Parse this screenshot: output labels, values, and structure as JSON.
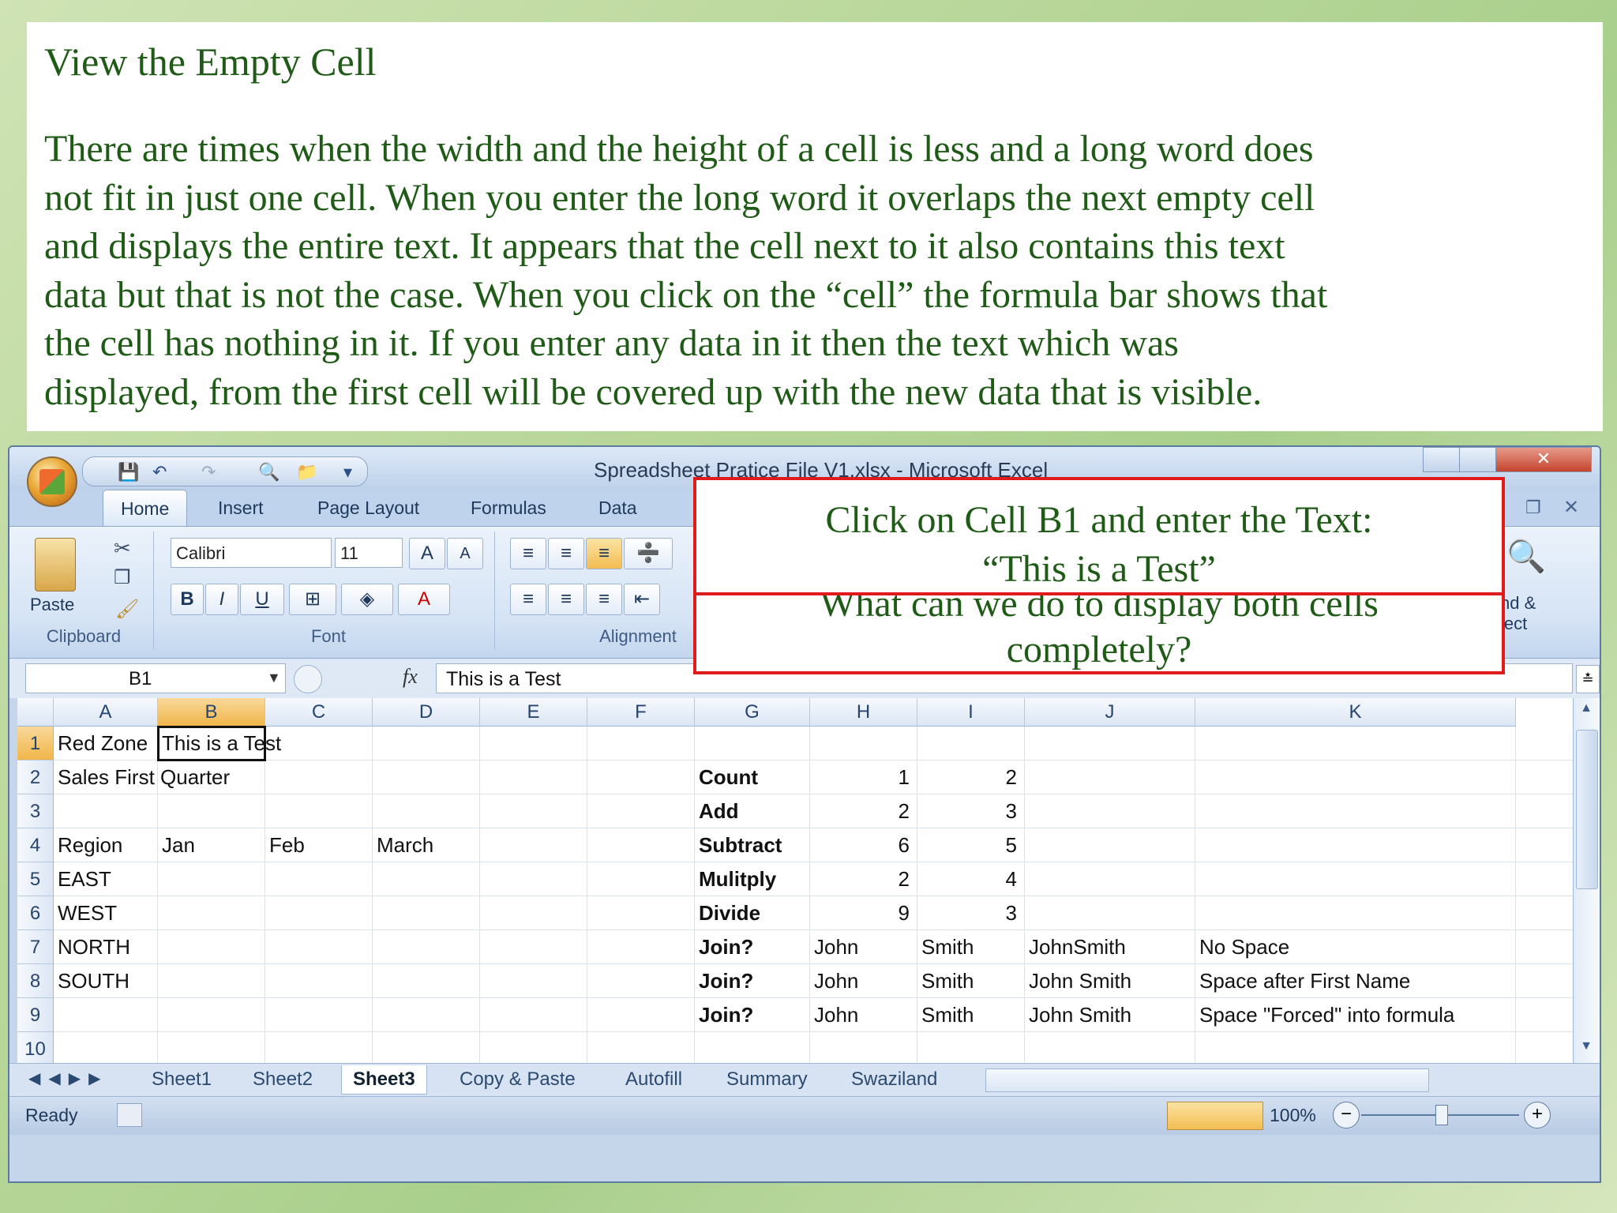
{
  "slide": {
    "title": "View the Empty Cell",
    "body_lines": [
      "There are times when the width and the height of a cell is less and a long word does",
      "not fit in just one cell.  When you enter the long word it overlaps the next empty cell",
      "and displays the entire text.  It appears that the cell next to it also contains this text",
      "data but that is not the case.  When you click on the “cell” the formula bar shows that",
      "the cell has nothing in it.  If you enter any data in it then the text which was",
      "displayed, from the first cell will be covered up with the new data that is visible."
    ]
  },
  "window": {
    "title": "Spreadsheet Pratice File V1.xlsx - Microsoft Excel"
  },
  "ribbon": {
    "tabs": [
      "Home",
      "Insert",
      "Page Layout",
      "Formulas",
      "Data"
    ],
    "groups": {
      "clipboard": "Clipboard",
      "font": "Font",
      "alignment": "Alignment"
    },
    "paste_label": "Paste",
    "font_name": "Calibri",
    "font_size": "11",
    "find_select_label": "nd &\nlect"
  },
  "formula_bar": {
    "name_box": "B1",
    "fx": "fx",
    "content": "This is a Test"
  },
  "grid": {
    "columns": [
      "A",
      "B",
      "C",
      "D",
      "E",
      "F",
      "G",
      "H",
      "I",
      "J",
      "K"
    ],
    "rows": [
      "1",
      "2",
      "3",
      "4",
      "5",
      "6",
      "7",
      "8",
      "9",
      "10"
    ],
    "cells": {
      "A1": "Red Zone",
      "B1": "This is a Test",
      "A2": "Sales First Quarter",
      "A4": "Region",
      "B4": "Jan",
      "C4": "Feb",
      "D4": "March",
      "A5": "EAST",
      "A6": "WEST",
      "A7": "NORTH",
      "A8": "SOUTH",
      "G2": "Count",
      "H2": "1",
      "I2": "2",
      "G3": "Add",
      "H3": "2",
      "I3": "3",
      "G4": "Subtract",
      "H4": "6",
      "I4": "5",
      "G5": "Mulitply",
      "H5": "2",
      "I5": "4",
      "G6": "Divide",
      "H6": "9",
      "I6": "3",
      "G7": "Join?",
      "H7": "John",
      "I7": "Smith",
      "J7": "JohnSmith",
      "K7": "No Space",
      "G8": "Join?",
      "H8": "John",
      "I8": "Smith",
      "J8": "John Smith",
      "K8": "Space after First Name",
      "G9": "Join?",
      "H9": "John",
      "I9": "Smith",
      "J9": "John Smith",
      "K9": "Space \"Forced\" into formula"
    }
  },
  "sheet_tabs": [
    "Sheet1",
    "Sheet2",
    "Sheet3",
    "Copy & Paste",
    "Autofill",
    "Summary",
    "Swaziland"
  ],
  "active_sheet": "Sheet3",
  "status": {
    "ready": "Ready",
    "zoom": "100%"
  },
  "callouts": {
    "top": [
      "Click on Cell B1 and enter the Text:",
      "“This is a Test”"
    ],
    "bottom": [
      "What can we do to display both cells",
      "completely?"
    ]
  },
  "colors": {
    "slide_text": "#1f5b17",
    "callout_border": "#e01b1b",
    "selected_header": "#f1b64a"
  }
}
